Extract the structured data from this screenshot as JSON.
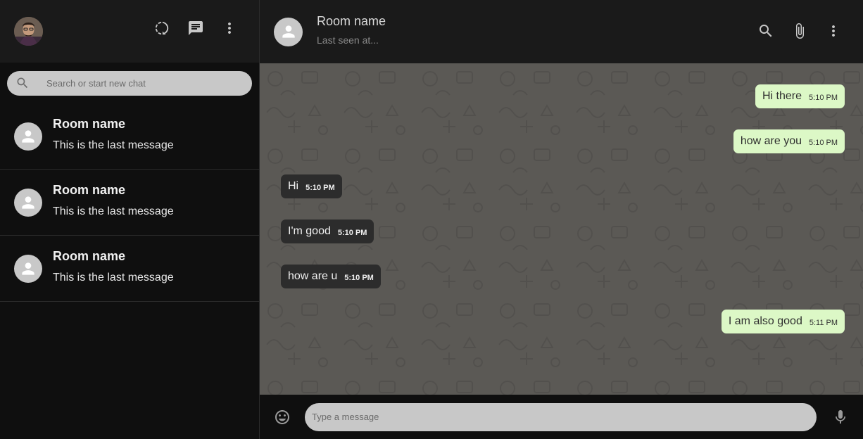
{
  "sidebar": {
    "search": {
      "placeholder": "Search or start new chat"
    },
    "chats": [
      {
        "name": "Room name",
        "last_message": "This is the last message"
      },
      {
        "name": "Room name",
        "last_message": "This is the last message"
      },
      {
        "name": "Room name",
        "last_message": "This is the last message"
      }
    ],
    "header_icons": [
      "status-icon",
      "chat-icon",
      "more-vert-icon"
    ]
  },
  "chat_header": {
    "room_name": "Room name",
    "last_seen": "Last seen at...",
    "icons": [
      "search-icon",
      "attach-icon",
      "more-vert-icon"
    ]
  },
  "messages": [
    {
      "text": "Hi there",
      "time": "5:10 PM",
      "direction": "sent"
    },
    {
      "text": "how are you",
      "time": "5:10 PM",
      "direction": "sent"
    },
    {
      "text": "Hi",
      "time": "5:10 PM",
      "direction": "received"
    },
    {
      "text": "I'm good",
      "time": "5:10 PM",
      "direction": "received"
    },
    {
      "text": "how are u",
      "time": "5:10 PM",
      "direction": "received"
    },
    {
      "text": "I am also good",
      "time": "5:11 PM",
      "direction": "sent"
    }
  ],
  "composer": {
    "placeholder": "Type a message",
    "icons": [
      "emoji-icon",
      "mic-icon"
    ]
  },
  "colors": {
    "sent_bubble": "#dcf8c6",
    "received_bubble": "#2c2c2c",
    "chat_background": "#5b5955",
    "header_background": "#1a1a1a"
  }
}
